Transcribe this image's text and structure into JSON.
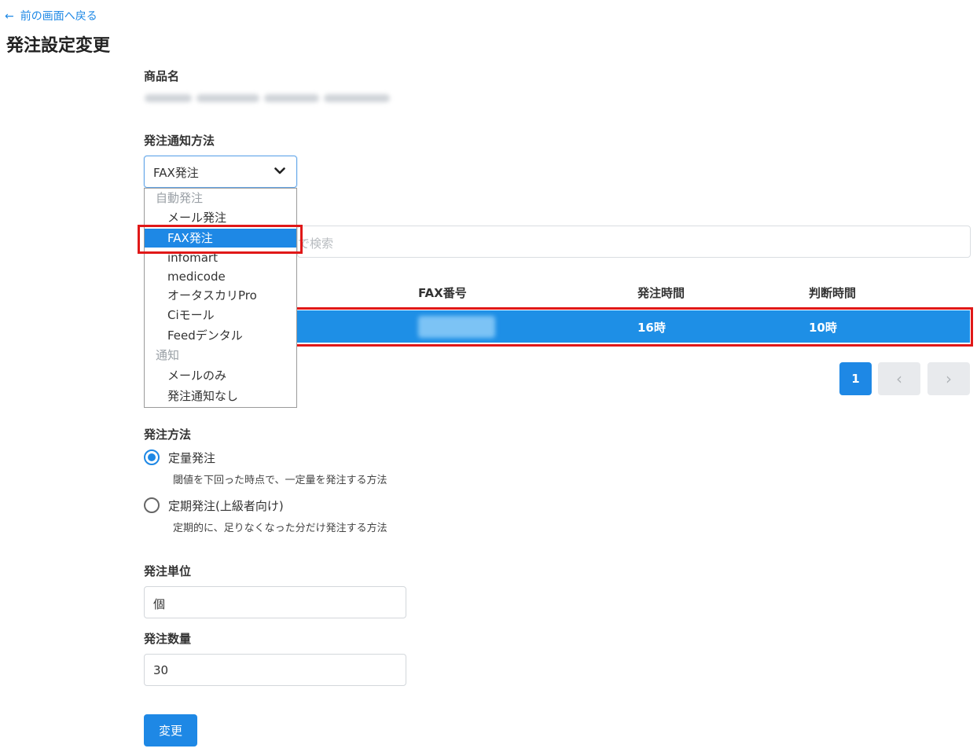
{
  "nav": {
    "back_label": "前の画面へ戻る",
    "back_arrow": "←"
  },
  "page": {
    "title": "発注設定変更"
  },
  "product": {
    "label": "商品名"
  },
  "notify": {
    "label": "発注通知方法",
    "selected_value": "FAX発注",
    "dropdown": {
      "group_auto": "自動発注",
      "opt_mail": "メール発注",
      "opt_fax": "FAX発注",
      "opt_infomart": "infomart",
      "opt_medicode": "medicode",
      "opt_otaskari": "オータスカリPro",
      "opt_ci": "Ciモール",
      "opt_feed": "Feedデンタル",
      "group_notify": "通知",
      "opt_mail_only": "メールのみ",
      "opt_none": "発注通知なし"
    }
  },
  "supplier": {
    "search_placeholder": "で検索",
    "table": {
      "headers": {
        "fax": "FAX番号",
        "order_time": "発注時間",
        "judge_time": "判断時間"
      },
      "selected_row": {
        "order_time": "16時",
        "judge_time": "10時"
      }
    },
    "pagination": {
      "current": "1",
      "prev": "‹",
      "next": "›"
    }
  },
  "method": {
    "label": "発注方法",
    "options": [
      {
        "label": "定量発注",
        "desc": "閾値を下回った時点で、一定量を発注する方法",
        "selected": true
      },
      {
        "label": "定期発注(上級者向け)",
        "desc": "定期的に、足りなくなった分だけ発注する方法",
        "selected": false
      }
    ]
  },
  "unit": {
    "label": "発注単位",
    "value": "個"
  },
  "quantity": {
    "label": "発注数量",
    "value": "30"
  },
  "submit": {
    "label": "変更"
  },
  "colors": {
    "accent": "#1e88e5",
    "highlight": "#e01818"
  }
}
